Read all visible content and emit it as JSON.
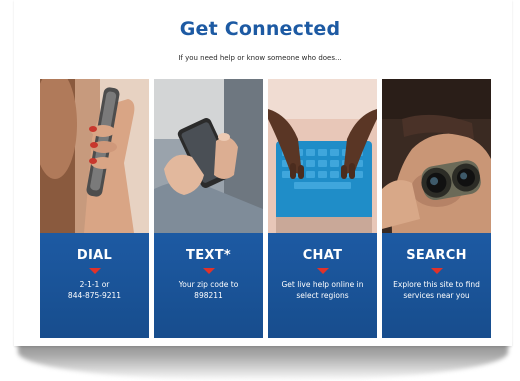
{
  "header": {
    "title": "Get Connected",
    "subtitle": "If you need help or know someone who does..."
  },
  "cards": [
    {
      "title": "DIAL",
      "line1": "2-1-1 or",
      "line2": "844-875-9211",
      "photo": "hand-holding-phone-to-ear"
    },
    {
      "title": "TEXT*",
      "line1": "Your zip code to",
      "line2": "898211",
      "photo": "hands-texting-on-smartphone"
    },
    {
      "title": "CHAT",
      "line1": "Get live help online in",
      "line2": "select regions",
      "photo": "hands-typing-on-keyboard"
    },
    {
      "title": "SEARCH",
      "line1": "Explore this site to find",
      "line2": "services near you",
      "photo": "person-with-binoculars"
    }
  ],
  "colors": {
    "brand_blue": "#1d5aa3",
    "accent_red": "#e1322a",
    "text_dark": "#2a2a2a"
  }
}
